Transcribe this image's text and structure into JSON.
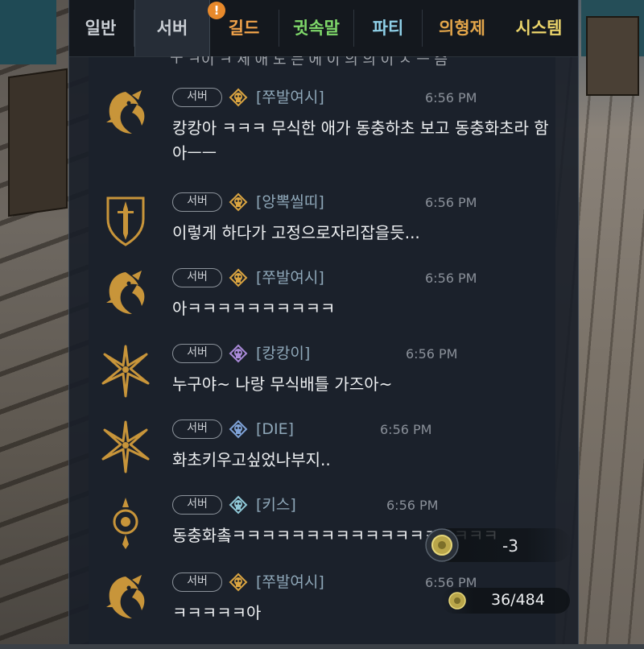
{
  "tabs": [
    {
      "label": "일반",
      "color": "#c9ced4",
      "active": false
    },
    {
      "label": "서버",
      "color": "#c9ced4",
      "active": true
    },
    {
      "label": "길드",
      "color": "#f0a24a",
      "active": false,
      "alert": "!"
    },
    {
      "label": "귓속말",
      "color": "#7fd86a",
      "active": false
    },
    {
      "label": "파티",
      "color": "#8fd0e8",
      "active": false
    },
    {
      "label": "의형제",
      "color": "#e4a64a",
      "active": false
    },
    {
      "label": "시스템",
      "color": "#ead36a",
      "active": false
    }
  ],
  "scroll_fragment": "ㅜ ㅋ이 ㅋ 세 애 도 는 에 이 의 의 이 ㅅ ㅡ 슴",
  "messages": [
    {
      "channel": "서버",
      "user": "[쭈발여시]",
      "time": "6:56 PM",
      "text": "캉캉아 ㅋㅋㅋ 무식한 애가 동충하초 보고 동충화초라 함 아ㅡㅡ",
      "avatar": "dragon-emblem",
      "badge": "gold-skull"
    },
    {
      "channel": "서버",
      "user": "[앙뽁씰띠]",
      "time": "6:56 PM",
      "text": "이렇게 하다가 고정으로자리잡을듯...",
      "avatar": "sword-shield-emblem",
      "badge": "gold-skull"
    },
    {
      "channel": "서버",
      "user": "[쭈발여시]",
      "time": "6:56 PM",
      "text": "아ㅋㅋㅋㅋㅋㅋㅋㅋㅋㅋ",
      "avatar": "dragon-emblem",
      "badge": "gold-skull"
    },
    {
      "channel": "서버",
      "user": "[캉캉이]",
      "time": "6:56 PM",
      "text": "누구야~ 나랑 무식배틀 가즈아~",
      "avatar": "star-emblem",
      "badge": "purple-skull"
    },
    {
      "channel": "서버",
      "user": "[DIE]",
      "time": "6:56 PM",
      "text": "화초키우고싶었나부지..",
      "avatar": "star-emblem",
      "badge": "blue-skull"
    },
    {
      "channel": "서버",
      "user": "[키스]",
      "time": "6:56 PM",
      "text": "동충화촠ㅋㅋㅋㅋㅋㅋㅋㅋㅋㅋㅋㅋㅋㅋㅋㅋㅋㅋ",
      "avatar": "orb-emblem",
      "badge": "teal-skull"
    },
    {
      "channel": "서버",
      "user": "[쭈발여시]",
      "time": "6:56 PM",
      "text": "ㅋㅋㅋㅋㅋ아",
      "avatar": "dragon-emblem",
      "badge": "gold-skull"
    }
  ],
  "hud": {
    "damage_value": "-3",
    "item_count": "36/484",
    "coin_icon": "gold-coin-icon"
  },
  "colors": {
    "username": "#8fa8b9",
    "timestamp": "#8a9099",
    "message_text": "#eef0f2",
    "emblem_gold": "#c8953a",
    "panel_bg": "#181e28"
  }
}
